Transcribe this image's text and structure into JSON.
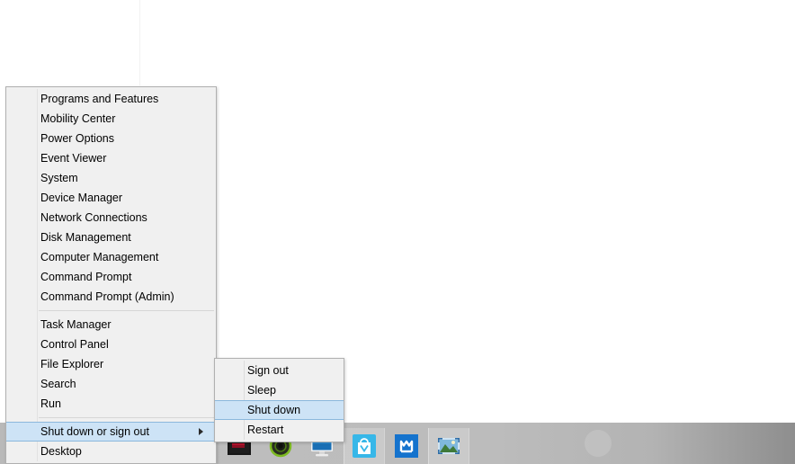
{
  "desktop": {
    "background_color": "#ffffff"
  },
  "power_menu": {
    "name": "Win+X power user menu",
    "groups": [
      {
        "items": [
          {
            "label": "Programs and Features",
            "selected": false,
            "submenu": false
          },
          {
            "label": "Mobility Center",
            "selected": false,
            "submenu": false
          },
          {
            "label": "Power Options",
            "selected": false,
            "submenu": false
          },
          {
            "label": "Event Viewer",
            "selected": false,
            "submenu": false
          },
          {
            "label": "System",
            "selected": false,
            "submenu": false
          },
          {
            "label": "Device Manager",
            "selected": false,
            "submenu": false
          },
          {
            "label": "Network Connections",
            "selected": false,
            "submenu": false
          },
          {
            "label": "Disk Management",
            "selected": false,
            "submenu": false
          },
          {
            "label": "Computer Management",
            "selected": false,
            "submenu": false
          },
          {
            "label": "Command Prompt",
            "selected": false,
            "submenu": false
          },
          {
            "label": "Command Prompt (Admin)",
            "selected": false,
            "submenu": false
          }
        ]
      },
      {
        "items": [
          {
            "label": "Task Manager",
            "selected": false,
            "submenu": false
          },
          {
            "label": "Control Panel",
            "selected": false,
            "submenu": false
          },
          {
            "label": "File Explorer",
            "selected": false,
            "submenu": false
          },
          {
            "label": "Search",
            "selected": false,
            "submenu": false
          },
          {
            "label": "Run",
            "selected": false,
            "submenu": false
          }
        ]
      },
      {
        "items": [
          {
            "label": "Shut down or sign out",
            "selected": true,
            "submenu": true
          },
          {
            "label": "Desktop",
            "selected": false,
            "submenu": false
          }
        ]
      }
    ]
  },
  "shutdown_submenu": {
    "name": "Shut down or sign out submenu",
    "items": [
      {
        "label": "Sign out",
        "selected": false
      },
      {
        "label": "Sleep",
        "selected": false
      },
      {
        "label": "Shut down",
        "selected": true
      },
      {
        "label": "Restart",
        "selected": false
      }
    ]
  },
  "taskbar": {
    "buttons": [
      {
        "icon": "media-player-icon",
        "active": false
      },
      {
        "icon": "disc-drive-icon",
        "active": false
      },
      {
        "icon": "this-pc-icon",
        "active": false
      },
      {
        "icon": "store-icon",
        "active": true
      },
      {
        "icon": "maxthon-browser-icon",
        "active": false
      },
      {
        "icon": "photos-icon",
        "active": true
      }
    ]
  },
  "colors": {
    "menu_background": "#f0f0f0",
    "menu_border": "#b0b0b0",
    "highlight_fill": "#cde3f6",
    "highlight_border": "#8bb8dd",
    "text": "#000000",
    "taskbar": "#bcbcbc"
  }
}
